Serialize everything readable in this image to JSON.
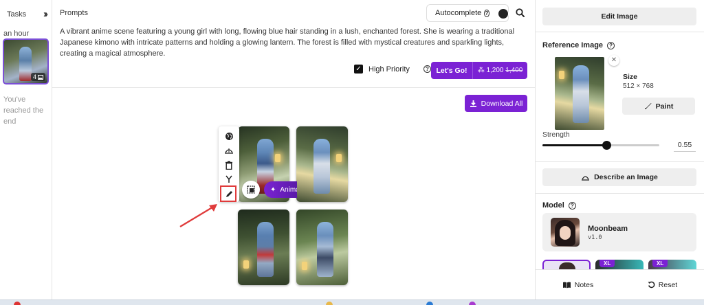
{
  "tasks": {
    "title": "Tasks",
    "collapse_icon": "double-chevron-right-icon",
    "time_group": "an hour",
    "thumb_badge": "4",
    "end_text": "You've reached the end"
  },
  "prompts": {
    "label": "Prompts",
    "autocomplete_label": "Autocomplete",
    "autocomplete_on": true,
    "text": "A vibrant anime scene featuring a young girl with long, flowing blue hair standing in a lush, enchanted forest. She is wearing a traditional Japanese kimono with intricate patterns and holding a glowing lantern. The forest is filled with mystical creatures and sparkling lights, creating a magical atmosphere.",
    "high_priority_label": "High Priority",
    "high_priority_checked": true,
    "lets_go_label": "Let's Go!",
    "cost_new": "1,200",
    "cost_old": "1,400"
  },
  "results": {
    "download_all_label": "Download All",
    "animate_label": "Animate",
    "toolbar_icons": [
      "globe-icon",
      "upscale-icon",
      "trash-icon",
      "branch-icon",
      "pencil-icon"
    ]
  },
  "right_panel": {
    "edit_image_label": "Edit Image",
    "reference_image_label": "Reference Image",
    "size_label": "Size",
    "size_value": "512 × 768",
    "paint_label": "Paint",
    "strength_label": "Strength",
    "strength_value": "0.55",
    "strength_fraction": 0.55,
    "describe_label": "Describe an Image",
    "model_label": "Model",
    "model_name": "Moonbeam",
    "model_version": "v1.0",
    "xl_badge": "XL",
    "notes_label": "Notes",
    "reset_label": "Reset"
  },
  "colors": {
    "accent": "#7b22d4",
    "highlight": "#e03b3b"
  }
}
